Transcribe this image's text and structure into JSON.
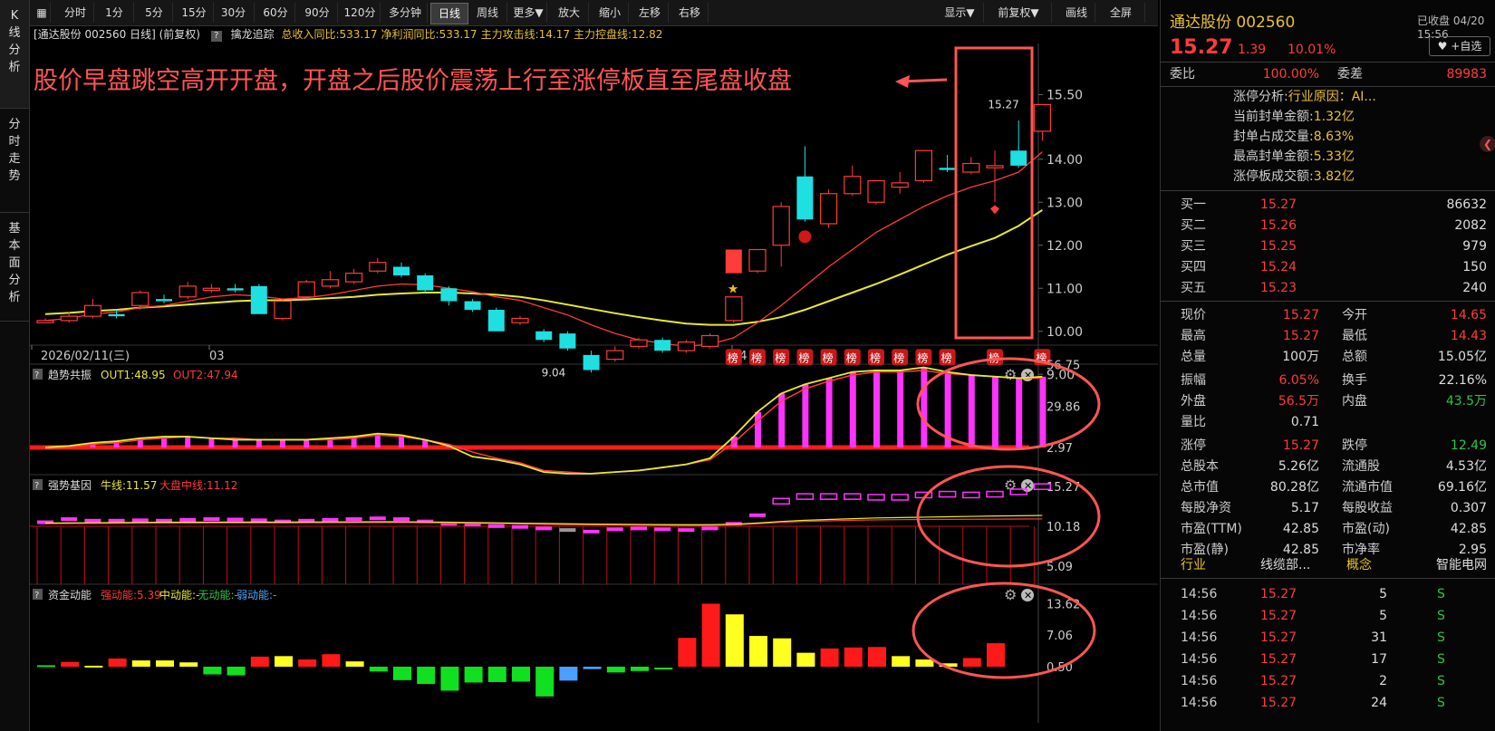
{
  "sidebar": [
    {
      "label": "K线分析",
      "active": true
    },
    {
      "label": "分时走势",
      "active": false
    },
    {
      "label": "基本面分析",
      "active": false
    }
  ],
  "toolbar": [
    {
      "label": "分时"
    },
    {
      "label": "1分"
    },
    {
      "label": "5分"
    },
    {
      "label": "15分"
    },
    {
      "label": "30分"
    },
    {
      "label": "60分"
    },
    {
      "label": "90分"
    },
    {
      "label": "120分"
    },
    {
      "label": "多分钟"
    },
    {
      "label": "日线",
      "active": true
    },
    {
      "label": "周线"
    },
    {
      "label": "更多▼"
    },
    {
      "label": "放大"
    },
    {
      "label": "缩小"
    },
    {
      "label": "左移"
    },
    {
      "label": "右移"
    },
    {
      "label": "显示▼"
    },
    {
      "label": "前复权▼"
    },
    {
      "label": "画线"
    },
    {
      "label": "全屏"
    }
  ],
  "info": {
    "title": "[通达股份 002560 日线] (前复权)",
    "help": "?",
    "indicator": "擒龙追踪",
    "items": [
      {
        "text": "总收入同比:533.17",
        "color": "#e8c030"
      },
      {
        "text": "净利润同比:533.17",
        "color": "#e8c030"
      },
      {
        "text": "主力攻击线:14.17",
        "color": "#e8c030"
      },
      {
        "text": "主力控盘线:12.82",
        "color": "#e8c030"
      }
    ]
  },
  "annotation": "股价早盘跳空高开开盘，开盘之后股价震荡上行至涨停板直至尾盘收盘",
  "main_chart": {
    "y_ticks": [
      "15.50",
      "14.00",
      "13.00",
      "12.00",
      "11.00",
      "10.00",
      "9.00"
    ],
    "x_labels": [
      "2026/02/11(三)",
      "03",
      "04"
    ],
    "high_label": "15.27",
    "low_label": "9.04",
    "bang_label": "榜"
  },
  "panel1": {
    "help": "?",
    "name": "趋势共振",
    "items": [
      {
        "text": "OUT1:48.95",
        "color": "#e8e830"
      },
      {
        "text": "OUT2:47.94",
        "color": "#ff3b3b"
      }
    ],
    "y_ticks": [
      "56.75",
      "29.86",
      "2.97"
    ]
  },
  "panel2": {
    "help": "?",
    "name": "强势基因",
    "items": [
      {
        "text": "牛线:11.57",
        "color": "#e8e830"
      },
      {
        "text": "大盘中线:11.12",
        "color": "#ff3b3b"
      }
    ],
    "y_ticks": [
      "15.27",
      "10.18",
      "5.09"
    ]
  },
  "panel3": {
    "help": "?",
    "name": "资金动能",
    "items": [
      {
        "text": "强动能:5.39",
        "color": "#ff3b3b"
      },
      {
        "text": "中动能:-",
        "color": "#e8e830"
      },
      {
        "text": "无动能:-",
        "color": "#2fc24a"
      },
      {
        "text": "弱动能:-",
        "color": "#4aa8ff"
      }
    ],
    "y_ticks": [
      "13.62",
      "7.06",
      "0.50"
    ]
  },
  "chart_data": {
    "type": "candlestick",
    "candles": [
      [
        10.2,
        10.25,
        10.3,
        10.2
      ],
      [
        10.25,
        10.35,
        10.45,
        10.2
      ],
      [
        10.35,
        10.6,
        10.75,
        10.3
      ],
      [
        10.4,
        10.35,
        10.5,
        10.3
      ],
      [
        10.6,
        10.9,
        10.95,
        10.5
      ],
      [
        10.75,
        10.7,
        10.85,
        10.65
      ],
      [
        10.8,
        11.05,
        11.15,
        10.75
      ],
      [
        10.95,
        11.0,
        11.1,
        10.9
      ],
      [
        11.0,
        10.95,
        11.1,
        10.9
      ],
      [
        11.05,
        10.4,
        11.1,
        10.4
      ],
      [
        10.3,
        10.7,
        10.75,
        10.25
      ],
      [
        10.8,
        11.15,
        11.2,
        10.75
      ],
      [
        11.05,
        11.2,
        11.4,
        11.0
      ],
      [
        11.15,
        11.35,
        11.45,
        11.1
      ],
      [
        11.4,
        11.6,
        11.7,
        11.35
      ],
      [
        11.5,
        11.3,
        11.6,
        11.25
      ],
      [
        11.3,
        10.95,
        11.35,
        10.9
      ],
      [
        11.0,
        10.7,
        11.05,
        10.6
      ],
      [
        10.7,
        10.5,
        10.75,
        10.45
      ],
      [
        10.5,
        10.0,
        10.55,
        10.0
      ],
      [
        10.2,
        10.3,
        10.35,
        10.15
      ],
      [
        10.0,
        9.8,
        10.05,
        9.75
      ],
      [
        9.95,
        9.6,
        10.0,
        9.55
      ],
      [
        9.45,
        9.1,
        9.55,
        9.04
      ],
      [
        9.35,
        9.55,
        9.65,
        9.3
      ],
      [
        9.65,
        9.8,
        9.85,
        9.6
      ],
      [
        9.8,
        9.55,
        9.85,
        9.5
      ],
      [
        9.55,
        9.75,
        9.8,
        9.5
      ],
      [
        9.65,
        9.9,
        9.95,
        9.6
      ],
      [
        10.25,
        10.8,
        10.8,
        10.2
      ],
      [
        11.4,
        11.9,
        11.9,
        11.35
      ],
      [
        12.0,
        12.9,
        13.0,
        11.5
      ],
      [
        13.6,
        12.6,
        14.3,
        12.55
      ],
      [
        12.5,
        13.2,
        13.3,
        12.4
      ],
      [
        13.2,
        13.6,
        13.85,
        13.15
      ],
      [
        13.0,
        13.5,
        13.5,
        12.95
      ],
      [
        13.35,
        13.45,
        13.7,
        13.2
      ],
      [
        13.5,
        14.2,
        14.2,
        13.45
      ],
      [
        13.8,
        13.75,
        14.1,
        13.7
      ],
      [
        13.7,
        13.9,
        14.05,
        13.65
      ],
      [
        13.8,
        13.85,
        14.2,
        13.0
      ],
      [
        14.2,
        13.85,
        14.9,
        13.8
      ],
      [
        14.65,
        15.27,
        15.27,
        14.43
      ]
    ],
    "ma_red": [
      10.25,
      10.3,
      10.4,
      10.45,
      10.55,
      10.6,
      10.7,
      10.8,
      10.85,
      10.82,
      10.75,
      10.78,
      10.85,
      10.95,
      11.05,
      11.1,
      11.08,
      11.0,
      10.92,
      10.8,
      10.72,
      10.55,
      10.38,
      10.15,
      9.95,
      9.8,
      9.72,
      9.65,
      9.7,
      9.85,
      10.2,
      10.6,
      11.05,
      11.5,
      11.9,
      12.3,
      12.6,
      12.9,
      13.15,
      13.35,
      13.5,
      13.7,
      14.17
    ],
    "ma_yellow": [
      10.4,
      10.43,
      10.47,
      10.5,
      10.55,
      10.58,
      10.62,
      10.66,
      10.7,
      10.72,
      10.72,
      10.74,
      10.77,
      10.8,
      10.85,
      10.88,
      10.9,
      10.9,
      10.88,
      10.85,
      10.8,
      10.72,
      10.62,
      10.52,
      10.42,
      10.33,
      10.25,
      10.18,
      10.15,
      10.15,
      10.22,
      10.33,
      10.5,
      10.7,
      10.9,
      11.1,
      11.32,
      11.55,
      11.78,
      11.98,
      12.17,
      12.45,
      12.82
    ],
    "flags": [
      29,
      30,
      31,
      32,
      33,
      34,
      35,
      36,
      37,
      38,
      40,
      42
    ],
    "panel1": {
      "out1": [
        3,
        4,
        6,
        7,
        9,
        10,
        10,
        9,
        8,
        8,
        8,
        8,
        9,
        10,
        12,
        11,
        8,
        4,
        -3,
        -5,
        -8,
        -13,
        -14,
        -14,
        -13,
        -12,
        -10,
        -8,
        -4,
        10,
        26,
        38,
        44,
        48,
        52,
        53,
        53,
        55,
        52,
        50,
        49,
        48,
        48.95
      ],
      "out2": [
        2,
        3,
        5,
        6,
        8,
        9,
        10,
        9,
        9,
        8,
        8,
        8,
        8,
        9,
        11,
        10,
        8,
        5,
        0,
        -4,
        -7,
        -12,
        -13,
        -14,
        -13,
        -12,
        -10,
        -8,
        -5,
        6,
        20,
        33,
        41,
        46,
        50,
        52,
        52,
        53,
        51,
        50,
        49,
        48,
        47.94
      ],
      "bars": [
        29,
        30,
        31,
        32,
        33,
        34,
        35,
        36,
        37,
        38,
        39,
        40,
        41,
        42,
        43
      ]
    },
    "panel2": {
      "bars": [
        10.7,
        11.1,
        10.9,
        10.9,
        10.95,
        10.9,
        11.0,
        11.1,
        11.05,
        10.95,
        10.8,
        10.9,
        11.0,
        11.1,
        11.2,
        11.1,
        10.8,
        10.5,
        10.4,
        10.2,
        10.1,
        9.9,
        9.7,
        9.5,
        9.8,
        9.9,
        9.8,
        9.7,
        9.9,
        10.5,
        11.6,
        13.4,
        14.0,
        14.0,
        14.0,
        13.9,
        13.9,
        14.2,
        14.3,
        14.2,
        14.3,
        14.6,
        15.27
      ],
      "niu": [
        10.6,
        10.62,
        10.64,
        10.66,
        10.68,
        10.7,
        10.7,
        10.72,
        10.72,
        10.72,
        10.72,
        10.73,
        10.74,
        10.75,
        10.76,
        10.76,
        10.74,
        10.7,
        10.66,
        10.62,
        10.58,
        10.54,
        10.5,
        10.46,
        10.44,
        10.42,
        10.4,
        10.38,
        10.38,
        10.45,
        10.6,
        10.8,
        10.95,
        11.05,
        11.15,
        11.25,
        11.3,
        11.35,
        11.4,
        11.45,
        11.5,
        11.53,
        11.57
      ],
      "dapan": [
        10.5,
        10.52,
        10.54,
        10.56,
        10.58,
        10.6,
        10.6,
        10.62,
        10.62,
        10.62,
        10.62,
        10.63,
        10.64,
        10.65,
        10.66,
        10.66,
        10.64,
        10.6,
        10.56,
        10.52,
        10.48,
        10.44,
        10.4,
        10.38,
        10.36,
        10.34,
        10.32,
        10.3,
        10.3,
        10.36,
        10.5,
        10.68,
        10.8,
        10.88,
        10.95,
        11.0,
        11.03,
        11.05,
        11.07,
        11.08,
        11.1,
        11.11,
        11.12
      ]
    },
    "panel3": {
      "values": [
        0.8,
        1.5,
        0.7,
        2.2,
        1.8,
        1.8,
        1.4,
        -1.6,
        -1.8,
        2.6,
        2.7,
        2.0,
        3.1,
        1.6,
        -1.0,
        -2.8,
        -3.6,
        -5.0,
        -3.3,
        -3.2,
        -3.1,
        -6.2,
        -2.9,
        -0.5,
        -1.2,
        -0.9,
        0.3,
        6.5,
        13.62,
        11.4,
        6.9,
        6.4,
        3.4,
        4.3,
        4.5,
        4.6,
        2.7,
        2.0,
        1.2,
        2.3,
        5.39
      ],
      "colors": [
        "g",
        "r",
        "y",
        "r",
        "y",
        "y",
        "y",
        "g",
        "g",
        "r",
        "y",
        "r",
        "r",
        "y",
        "g",
        "g",
        "g",
        "g",
        "g",
        "g",
        "g",
        "g",
        "b",
        "b",
        "g",
        "g",
        "g",
        "r",
        "r",
        "y",
        "y",
        "y",
        "y",
        "r",
        "r",
        "r",
        "y",
        "y",
        "y",
        "r",
        "r"
      ]
    }
  },
  "right": {
    "title": "通达股份 002560",
    "closed": "已收盘 04/20 15:56",
    "add_watch": "+自选",
    "price": "15.27",
    "change": "1.39",
    "pct": "10.01%",
    "weibi_label": "委比",
    "weibi": "100.00%",
    "weicha_label": "委差",
    "weicha": "89983",
    "analysis": [
      {
        "label": "涨停分析:",
        "value": "行业原因：AI..."
      },
      {
        "label": "当前封单金额:",
        "value": "1.32亿"
      },
      {
        "label": "封单占成交量:",
        "value": "8.63%"
      },
      {
        "label": "最高封单金额:",
        "value": "5.33亿"
      },
      {
        "label": "涨停板成交额:",
        "value": "3.82亿"
      }
    ],
    "bids": [
      {
        "label": "买一",
        "price": "15.27",
        "vol": "86632"
      },
      {
        "label": "买二",
        "price": "15.26",
        "vol": "2082"
      },
      {
        "label": "买三",
        "price": "15.25",
        "vol": "979"
      },
      {
        "label": "买四",
        "price": "15.24",
        "vol": "150"
      },
      {
        "label": "买五",
        "price": "15.23",
        "vol": "240"
      }
    ],
    "quote": [
      {
        "l1": "现价",
        "v1": "15.27",
        "c1": "red",
        "l2": "今开",
        "v2": "14.65",
        "c2": "red"
      },
      {
        "l1": "最高",
        "v1": "15.27",
        "c1": "red",
        "l2": "最低",
        "v2": "14.43",
        "c2": "red"
      },
      {
        "l1": "总量",
        "v1": "100万",
        "c1": "white",
        "l2": "总额",
        "v2": "15.05亿",
        "c2": "white"
      },
      {
        "l1": "振幅",
        "v1": "6.05%",
        "c1": "red",
        "l2": "换手",
        "v2": "22.16%",
        "c2": "white"
      },
      {
        "l1": "外盘",
        "v1": "56.5万",
        "c1": "red",
        "l2": "内盘",
        "v2": "43.5万",
        "c2": "green"
      },
      {
        "l1": "量比",
        "v1": "0.71",
        "c1": "white",
        "l2": "",
        "v2": "",
        "c2": "white"
      },
      {
        "l1": "涨停",
        "v1": "15.27",
        "c1": "red",
        "l2": "跌停",
        "v2": "12.49",
        "c2": "green"
      },
      {
        "l1": "总股本",
        "v1": "5.26亿",
        "c1": "white",
        "l2": "流通股",
        "v2": "4.53亿",
        "c2": "white"
      },
      {
        "l1": "总市值",
        "v1": "80.28亿",
        "c1": "white",
        "l2": "流通市值",
        "v2": "69.16亿",
        "c2": "white"
      },
      {
        "l1": "每股净资",
        "v1": "5.17",
        "c1": "white",
        "l2": "每股收益",
        "v2": "0.307",
        "c2": "white"
      },
      {
        "l1": "市盈(TTM)",
        "v1": "42.85",
        "c1": "white",
        "l2": "市盈(动)",
        "v2": "42.85",
        "c2": "white"
      },
      {
        "l1": "市盈(静)",
        "v1": "42.85",
        "c1": "white",
        "l2": "市净率",
        "v2": "2.95",
        "c2": "white"
      }
    ],
    "industry": {
      "l1": "行业",
      "v1": "线缆部...",
      "l2": "概念",
      "v2": "智能电网"
    },
    "ticks": [
      {
        "time": "14:56",
        "price": "15.27",
        "vol": "5",
        "dir": "S"
      },
      {
        "time": "14:56",
        "price": "15.27",
        "vol": "5",
        "dir": "S"
      },
      {
        "time": "14:56",
        "price": "15.27",
        "vol": "31",
        "dir": "S"
      },
      {
        "time": "14:56",
        "price": "15.27",
        "vol": "17",
        "dir": "S"
      },
      {
        "time": "14:56",
        "price": "15.27",
        "vol": "2",
        "dir": "S"
      },
      {
        "time": "14:56",
        "price": "15.27",
        "vol": "24",
        "dir": "S"
      }
    ]
  },
  "colors": {
    "up": "#ff3b3b",
    "down": "#1ee0e0",
    "ma_yellow": "#e8e830",
    "magenta": "#ff33ff",
    "annotation": "#ff5555",
    "gray": "#999999"
  }
}
